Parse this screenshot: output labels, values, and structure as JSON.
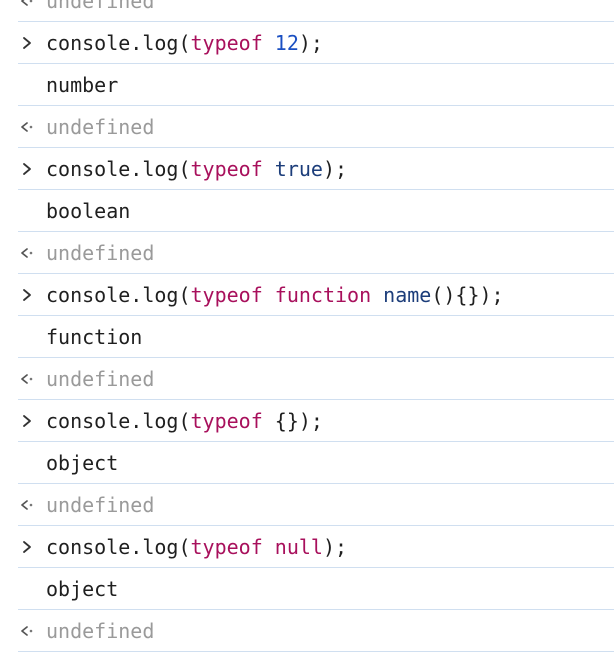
{
  "rows": [
    {
      "kind": "result",
      "text": "undefined"
    },
    {
      "kind": "input",
      "tokens": [
        {
          "t": "console.log(",
          "c": "plain"
        },
        {
          "t": "typeof",
          "c": "kw"
        },
        {
          "t": " ",
          "c": "plain"
        },
        {
          "t": "12",
          "c": "num"
        },
        {
          "t": ");",
          "c": "plain"
        }
      ]
    },
    {
      "kind": "output",
      "text": "number"
    },
    {
      "kind": "result",
      "text": "undefined"
    },
    {
      "kind": "input",
      "tokens": [
        {
          "t": "console.log(",
          "c": "plain"
        },
        {
          "t": "typeof",
          "c": "kw"
        },
        {
          "t": " ",
          "c": "plain"
        },
        {
          "t": "true",
          "c": "bool"
        },
        {
          "t": ");",
          "c": "plain"
        }
      ]
    },
    {
      "kind": "output",
      "text": "boolean"
    },
    {
      "kind": "result",
      "text": "undefined"
    },
    {
      "kind": "input",
      "tokens": [
        {
          "t": "console.log(",
          "c": "plain"
        },
        {
          "t": "typeof",
          "c": "kw"
        },
        {
          "t": " ",
          "c": "plain"
        },
        {
          "t": "function",
          "c": "kw"
        },
        {
          "t": " ",
          "c": "plain"
        },
        {
          "t": "name",
          "c": "fn"
        },
        {
          "t": "(){});",
          "c": "plain"
        }
      ]
    },
    {
      "kind": "output",
      "text": "function"
    },
    {
      "kind": "result",
      "text": "undefined"
    },
    {
      "kind": "input",
      "tokens": [
        {
          "t": "console.log(",
          "c": "plain"
        },
        {
          "t": "typeof",
          "c": "kw"
        },
        {
          "t": " {});",
          "c": "plain"
        }
      ]
    },
    {
      "kind": "output",
      "text": "object"
    },
    {
      "kind": "result",
      "text": "undefined"
    },
    {
      "kind": "input",
      "tokens": [
        {
          "t": "console.log(",
          "c": "plain"
        },
        {
          "t": "typeof",
          "c": "kw"
        },
        {
          "t": " ",
          "c": "plain"
        },
        {
          "t": "null",
          "c": "kw"
        },
        {
          "t": ");",
          "c": "plain"
        }
      ]
    },
    {
      "kind": "output",
      "text": "object"
    },
    {
      "kind": "result",
      "text": "undefined"
    }
  ],
  "icons": {
    "input": "chevron-right-icon",
    "result": "return-arrow-icon"
  },
  "colors": {
    "keyword": "#a8105c",
    "number": "#1a4fc2",
    "boolean": "#1c3d7a",
    "function_name": "#1c3d7a",
    "plain": "#1f1f1f",
    "result": "#9a9a9a",
    "divider": "#d0dff0"
  }
}
